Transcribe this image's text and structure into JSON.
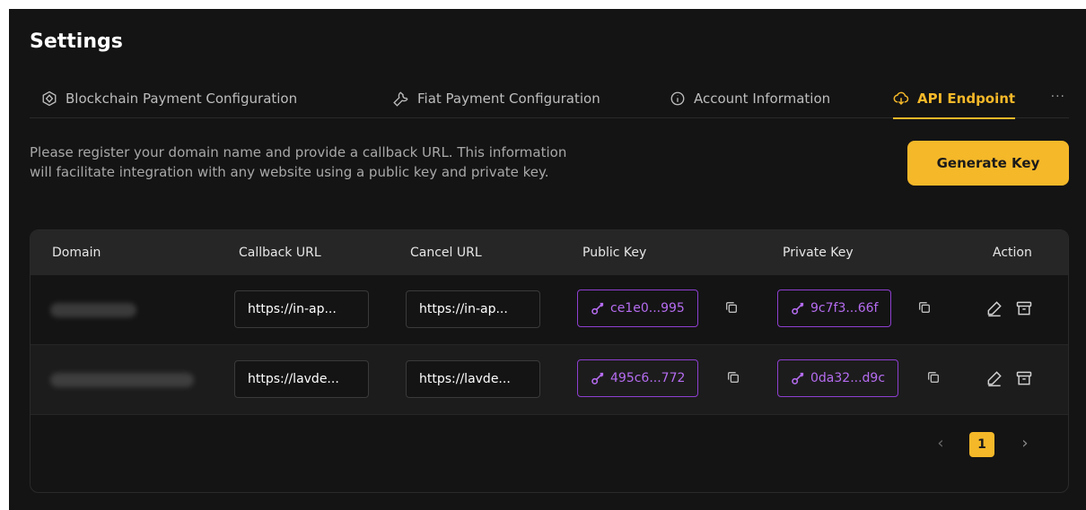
{
  "page": {
    "title": "Settings"
  },
  "tabs": [
    {
      "label": "Blockchain Payment Configuration",
      "icon": "blockchain-icon",
      "active": false
    },
    {
      "label": "Fiat Payment Configuration",
      "icon": "wrench-icon",
      "active": false
    },
    {
      "label": "Account Information",
      "icon": "info-icon",
      "active": false
    },
    {
      "label": "API Endpoint",
      "icon": "cloud-download-icon",
      "active": true
    }
  ],
  "tabs_more": "···",
  "description": "Please register your domain name and provide a callback URL. This information will facilitate integration with any website using a public key and private key.",
  "generate_button": "Generate Key",
  "table": {
    "columns": [
      "Domain",
      "Callback URL",
      "Cancel URL",
      "Public Key",
      "Private Key",
      "Action"
    ],
    "rows": [
      {
        "callback_url": "https://in-ap...",
        "cancel_url": "https://in-ap...",
        "public_key": "ce1e0...995",
        "private_key": "9c7f3...66f"
      },
      {
        "callback_url": "https://lavde...",
        "cancel_url": "https://lavde...",
        "public_key": "495c6...772",
        "private_key": "0da32...d9c"
      }
    ]
  },
  "pagination": {
    "prev": "‹",
    "current": "1",
    "next": "›"
  },
  "colors": {
    "accent": "#f5b829",
    "key_purple": "#b56cf0",
    "background": "#141414"
  }
}
